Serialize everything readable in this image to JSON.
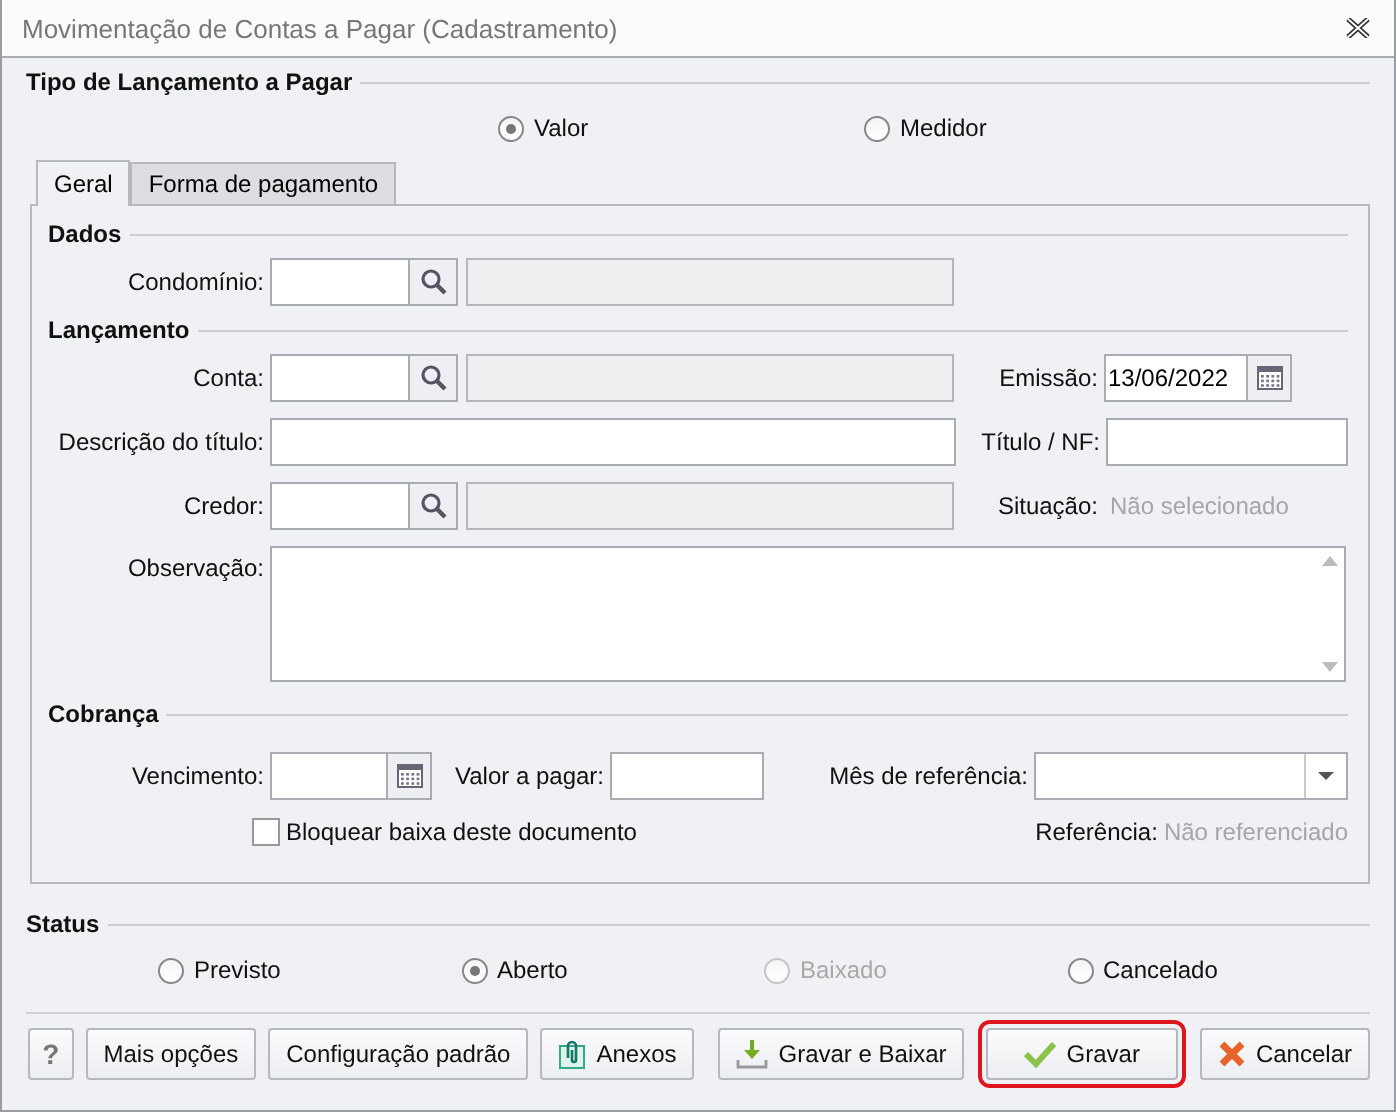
{
  "window": {
    "title": "Movimentação de Contas a Pagar (Cadastramento)"
  },
  "entry_type": {
    "title": "Tipo de Lançamento a Pagar",
    "options": [
      {
        "label": "Valor",
        "selected": true
      },
      {
        "label": "Medidor",
        "selected": false
      }
    ]
  },
  "tabs": [
    {
      "label": "Geral",
      "selected": true
    },
    {
      "label": "Forma de pagamento",
      "selected": false
    }
  ],
  "dados": {
    "title": "Dados",
    "condominio": {
      "label": "Condomínio:"
    }
  },
  "lancamento": {
    "title": "Lançamento",
    "conta": {
      "label": "Conta:"
    },
    "emissao": {
      "label": "Emissão:",
      "value": "13/06/2022"
    },
    "descricao": {
      "label": "Descrição do título:"
    },
    "titulo_nf": {
      "label": "Título / NF:"
    },
    "credor": {
      "label": "Credor:"
    },
    "situacao": {
      "label": "Situação:",
      "value": "Não selecionado"
    },
    "observacao": {
      "label": "Observação:"
    }
  },
  "cobranca": {
    "title": "Cobrança",
    "vencimento": {
      "label": "Vencimento:"
    },
    "valor_a_pagar": {
      "label": "Valor a pagar:"
    },
    "mes_referencia": {
      "label": "Mês de referência:"
    },
    "bloquear_baixa": {
      "label": "Bloquear baixa deste documento",
      "checked": false
    },
    "referencia": {
      "label": "Referência:",
      "value": "Não referenciado"
    }
  },
  "status": {
    "title": "Status",
    "options": [
      {
        "label": "Previsto",
        "selected": false,
        "disabled": false
      },
      {
        "label": "Aberto",
        "selected": true,
        "disabled": false
      },
      {
        "label": "Baixado",
        "selected": false,
        "disabled": true
      },
      {
        "label": "Cancelado",
        "selected": false,
        "disabled": false
      }
    ]
  },
  "left_buttons": [
    {
      "kind": "help",
      "label": "?"
    },
    {
      "kind": "plain",
      "label": "Mais opções"
    },
    {
      "kind": "plain",
      "label": "Configuração padrão"
    },
    {
      "kind": "paperclip",
      "label": "Anexos"
    }
  ],
  "right_buttons": [
    {
      "kind": "download",
      "label": "Gravar e Baixar",
      "highlighted": false
    },
    {
      "kind": "check",
      "label": "Gravar",
      "highlighted": true
    },
    {
      "kind": "cross",
      "label": "Cancelar",
      "highlighted": false
    }
  ]
}
